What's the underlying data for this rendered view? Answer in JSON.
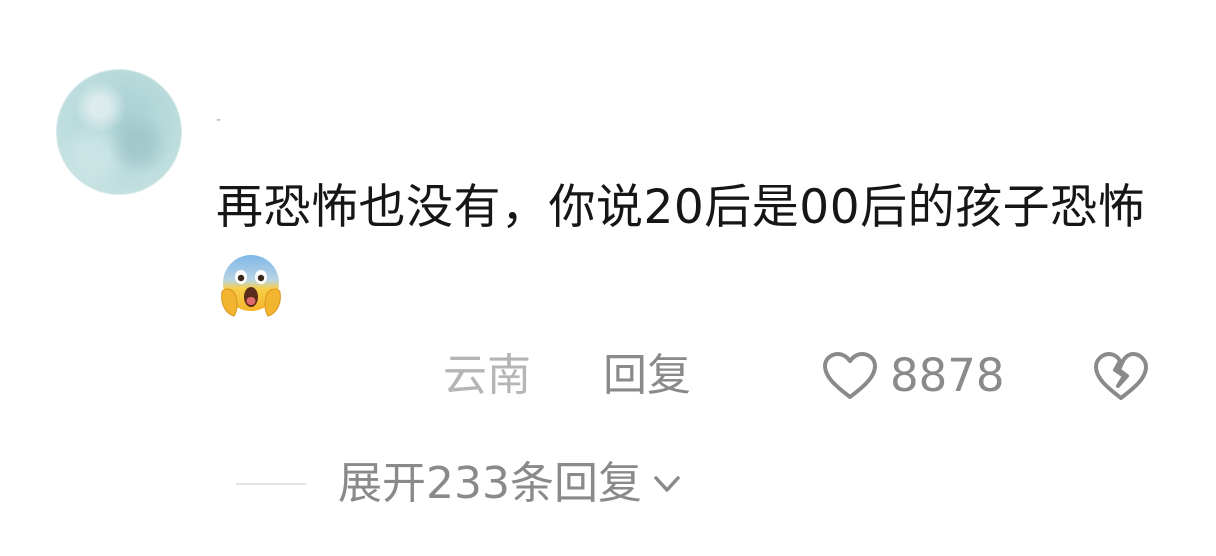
{
  "comment": {
    "username": "-",
    "text": "再恐怖也没有，你说20后是00后的孩子恐怖",
    "emoji": "screaming-face-emoji"
  },
  "meta": {
    "location": "云南",
    "reply_label": "回复",
    "like_count": "8878"
  },
  "replies": {
    "expand_label": "展开233条回复"
  },
  "colors": {
    "text_primary": "#161616",
    "text_secondary": "#8a8a8a",
    "text_muted": "#b5b5b5",
    "avatar": "#bcdcdd"
  }
}
